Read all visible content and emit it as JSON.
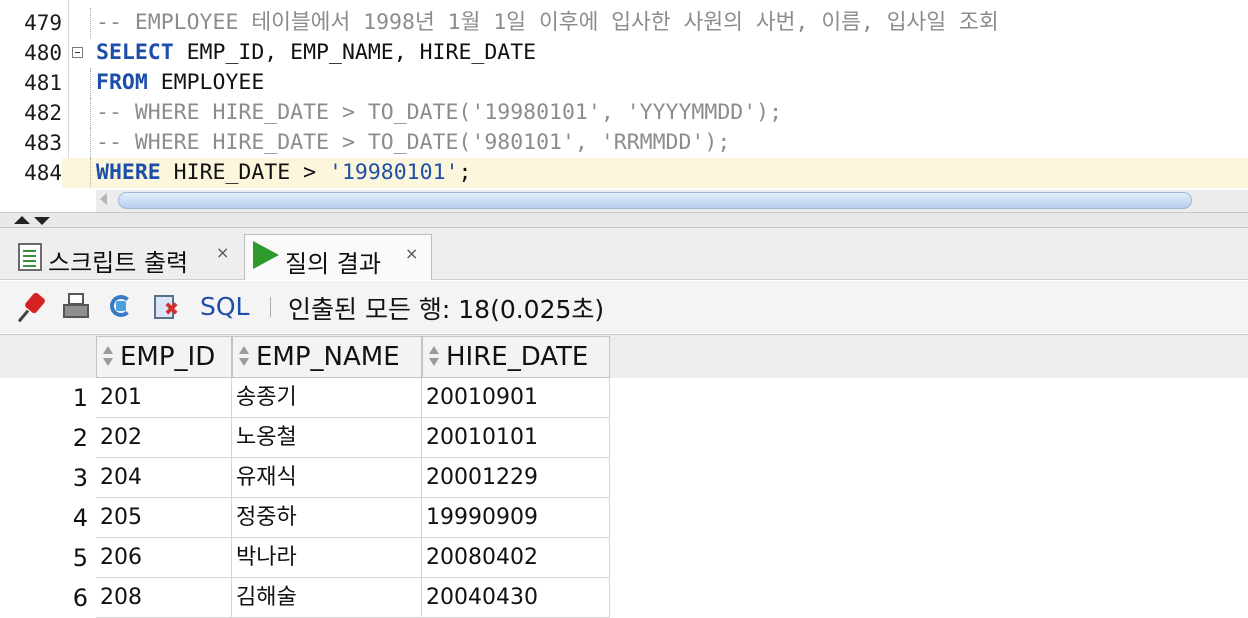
{
  "editor": {
    "lines": [
      {
        "num": "479",
        "tokens": [
          {
            "t": "-- EMPLOYEE 테이블에서 1998년 1월 1일 이후에 입사한 사원의 사번, 이름, 입사일 조회",
            "c": "cm"
          }
        ]
      },
      {
        "num": "480",
        "tokens": [
          {
            "t": "SELECT",
            "c": "kw"
          },
          {
            "t": " EMP_ID, EMP_NAME, HIRE_DATE",
            "c": "plain"
          }
        ]
      },
      {
        "num": "481",
        "tokens": [
          {
            "t": "FROM",
            "c": "kw"
          },
          {
            "t": " EMPLOYEE",
            "c": "plain"
          }
        ]
      },
      {
        "num": "482",
        "tokens": [
          {
            "t": "-- WHERE HIRE_DATE > TO_DATE('19980101', 'YYYYMMDD');",
            "c": "cm"
          }
        ]
      },
      {
        "num": "483",
        "tokens": [
          {
            "t": "-- WHERE HIRE_DATE > TO_DATE('980101', 'RRMMDD');",
            "c": "cm"
          }
        ]
      },
      {
        "num": "484",
        "tokens": [
          {
            "t": "WHERE",
            "c": "kw"
          },
          {
            "t": " HIRE_DATE > ",
            "c": "plain"
          },
          {
            "t": "'19980101'",
            "c": "str"
          },
          {
            "t": ";",
            "c": "plain"
          }
        ]
      }
    ]
  },
  "tabs": [
    {
      "label": "스크립트 출력",
      "close": "×"
    },
    {
      "label": "질의 결과",
      "close": "×"
    }
  ],
  "toolbar": {
    "sql_label": "SQL",
    "status": "인출된 모든 행: 18(0.025초)"
  },
  "grid": {
    "columns": [
      "EMP_ID",
      "EMP_NAME",
      "HIRE_DATE"
    ],
    "rows": [
      {
        "n": "1",
        "cells": [
          "201",
          "송종기",
          "20010901"
        ]
      },
      {
        "n": "2",
        "cells": [
          "202",
          "노옹철",
          "20010101"
        ]
      },
      {
        "n": "3",
        "cells": [
          "204",
          "유재식",
          "20001229"
        ]
      },
      {
        "n": "4",
        "cells": [
          "205",
          "정중하",
          "19990909"
        ]
      },
      {
        "n": "5",
        "cells": [
          "206",
          "박나라",
          "20080402"
        ]
      },
      {
        "n": "6",
        "cells": [
          "208",
          "김해술",
          "20040430"
        ]
      }
    ]
  }
}
